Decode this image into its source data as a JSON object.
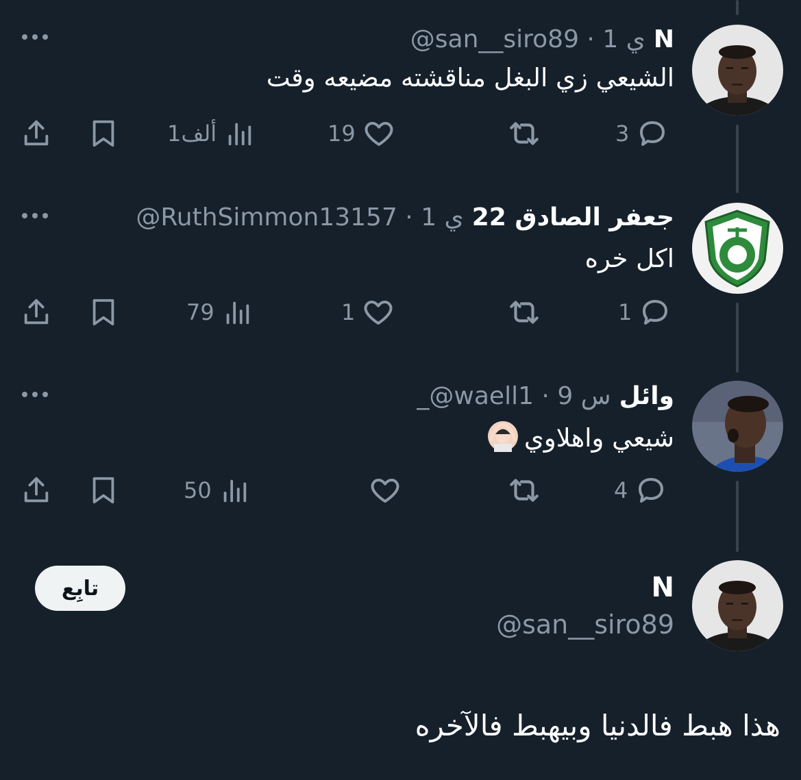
{
  "replies": [
    {
      "name": "N",
      "meta": "@san__siro89 · 1 ي",
      "text": "الشيعي زي البغل مناقشته مضيعه وقت",
      "stats": {
        "replies": "3",
        "retweets": "",
        "likes": "19",
        "views": "1ألف"
      }
    },
    {
      "name": "جعفر الصادق 22",
      "meta": "@RuthSimmon13157 · 1 ي",
      "text": "اكل خره",
      "stats": {
        "replies": "1",
        "retweets": "",
        "likes": "1",
        "views": "79"
      }
    },
    {
      "name": "وائل",
      "meta": "_@waell1 · 9 س",
      "text": "شيعي واهلاوي",
      "emoji": "person-gesturing-ok",
      "stats": {
        "replies": "4",
        "retweets": "",
        "likes": "",
        "views": "50"
      }
    }
  ],
  "main_tweet": {
    "name": "N",
    "handle": "@san__siro89",
    "follow_label": "تابِع",
    "text": "هذا هبط فالدنيا وبيهبط فالآخره"
  },
  "icons": [
    "reply-icon",
    "retweet-icon",
    "like-icon",
    "views-icon",
    "bookmark-icon",
    "share-icon",
    "more-icon"
  ],
  "colors": {
    "background": "#15202b",
    "muted": "#8b98a5",
    "thread_line": "#38444d",
    "follow_button": "#eff3f4"
  }
}
